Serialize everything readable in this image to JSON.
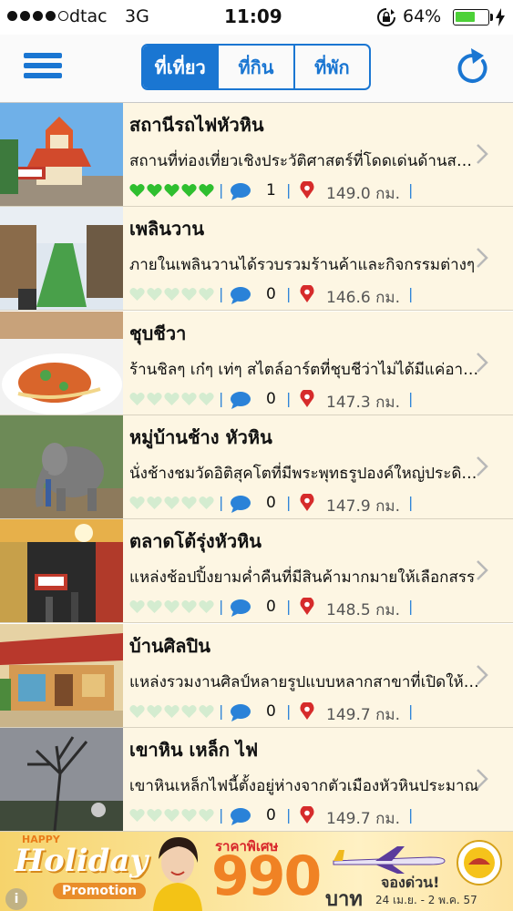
{
  "status_bar": {
    "carrier": "dtac",
    "network": "3G",
    "time": "11:09",
    "battery_percent": "64%",
    "battery_level": 0.64,
    "signal_bars": 4,
    "signal_total": 5
  },
  "nav": {
    "tabs": [
      {
        "label": "ที่เที่ยว",
        "active": true
      },
      {
        "label": "ที่กิน",
        "active": false
      },
      {
        "label": "ที่พัก",
        "active": false
      }
    ],
    "accent_color": "#1a76d2"
  },
  "list": {
    "items": [
      {
        "title": "สถานีรถไฟหัวหิน",
        "description": "สถานที่ท่องเที่ยวเชิงประวัติศาสตร์ที่โดดเด่นด้านสถาปัตยกรรม",
        "rating": 5,
        "comments": "1",
        "distance": "149.0 กม."
      },
      {
        "title": "เพลินวาน",
        "description": "ภายในเพลินวานได้รวบรวมร้านค้าและกิจกรรมต่างๆ",
        "rating": 0,
        "comments": "0",
        "distance": "146.6 กม."
      },
      {
        "title": "ชุบชีวา",
        "description": "ร้านชิลๆ เก๋ๆ เท่ๆ สไตล์อาร์ตที่ชุบชีว่าไม่ได้มีแค่อาหาร",
        "rating": 0,
        "comments": "0",
        "distance": "147.3 กม."
      },
      {
        "title": "หมู่บ้านช้าง หัวหิน",
        "description": "นั่งช้างชมวัดอิติสุคโตที่มีพระพุทธรูปองค์ใหญ่ประดิษฐาน",
        "rating": 0,
        "comments": "0",
        "distance": "147.9 กม."
      },
      {
        "title": "ตลาดโต้รุ่งหัวหิน",
        "description": "แหล่งช้อปปิ้งยามค่ำคืนที่มีสินค้ามากมายให้เลือกสรร",
        "rating": 0,
        "comments": "0",
        "distance": "148.5 กม."
      },
      {
        "title": "บ้านศิลปิน",
        "description": "แหล่งรวมงานศิลป์หลายรูปแบบหลากสาขาที่เปิดให้ชม",
        "rating": 0,
        "comments": "0",
        "distance": "149.7 กม."
      },
      {
        "title": "เขาหิน เหล็ก ไฟ",
        "description": "เขาหินเหล็กไฟนี้ตั้งอยู่ห่างจากตัวเมืองหัวหินประมาณ",
        "rating": 0,
        "comments": "0",
        "distance": "149.7 กม."
      }
    ],
    "separator": "|",
    "row_bg": "#fdf6e3",
    "heart_on_color": "#2fbf2f",
    "heart_off_color": "#d4ecd0"
  },
  "banner": {
    "happy": "HAPPY",
    "holiday": "Holiday",
    "promotion": "Promotion",
    "special": "ราคาพิเศษ",
    "price": "990",
    "baht": "บาท",
    "book": "จองด่วน!",
    "dates": "24 เม.ย. - 2 พ.ค. 57",
    "info": "i"
  }
}
